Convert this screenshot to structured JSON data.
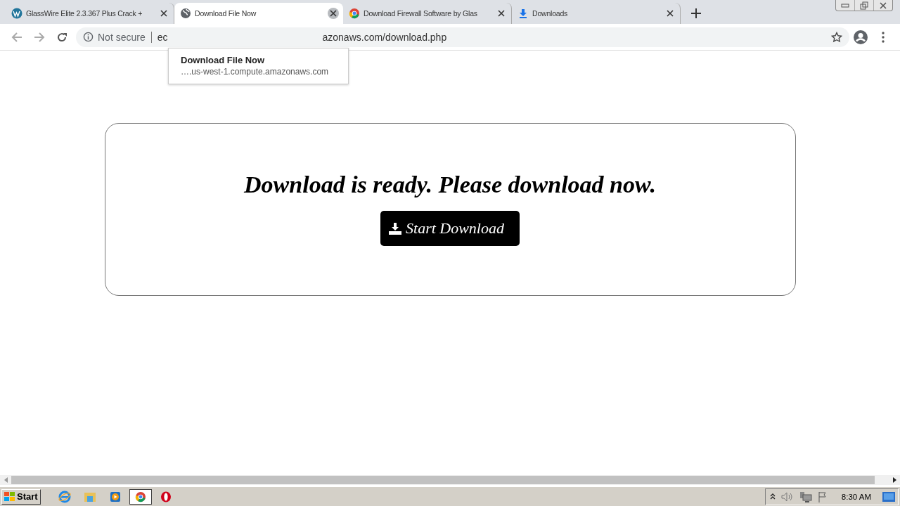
{
  "tabs": [
    {
      "title": "GlassWire Elite 2.3.367 Plus Crack +",
      "kind": "wordpress",
      "selected": false
    },
    {
      "title": "Download File Now",
      "kind": "globe",
      "selected": true
    },
    {
      "title": "Download Firewall Software by Glas",
      "kind": "chrome",
      "selected": false
    },
    {
      "title": "Downloads",
      "kind": "download",
      "selected": false
    }
  ],
  "address_bar": {
    "security": "Not secure",
    "url_start": "ec",
    "url_end": "azonaws.com/download.php"
  },
  "tab_tooltip": {
    "title": "Download File Now",
    "host": "….us-west-1.compute.amazonaws.com"
  },
  "page": {
    "heading": "Download is ready. Please download now.",
    "button": "Start Download"
  },
  "taskbar": {
    "start": "Start",
    "apps": [
      {
        "kind": "ie",
        "selected": false
      },
      {
        "kind": "explorer",
        "selected": false
      },
      {
        "kind": "media",
        "selected": false
      },
      {
        "kind": "chrome",
        "selected": true
      },
      {
        "kind": "opera",
        "selected": false
      }
    ],
    "clock": "8:30 AM"
  }
}
